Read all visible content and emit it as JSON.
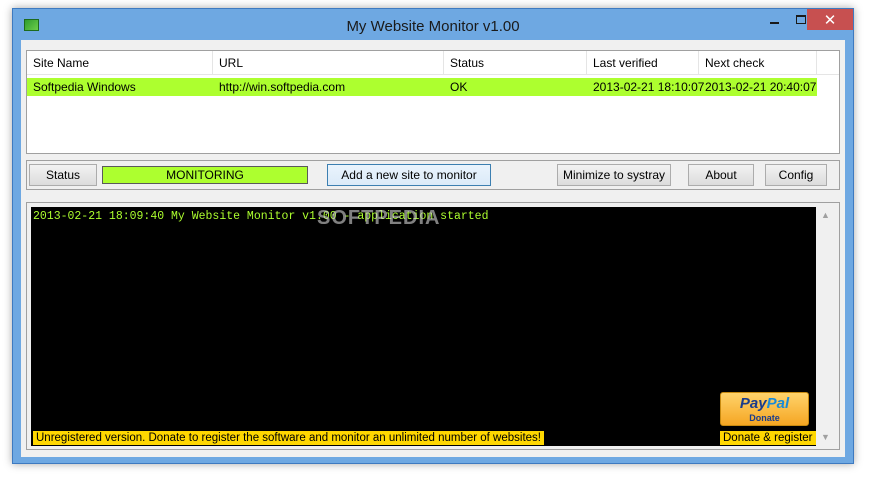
{
  "window": {
    "title": "My Website Monitor v1.00",
    "close_glyph": "✕"
  },
  "list": {
    "columns": [
      "Site Name",
      "URL",
      "Status",
      "Last verified",
      "Next check"
    ],
    "rows": [
      {
        "site_name": "Softpedia Windows",
        "url": "http://win.softpedia.com",
        "status": "OK",
        "last_verified": "2013-02-21 18:10:07",
        "next_check": "2013-02-21 20:40:07"
      }
    ]
  },
  "toolbar": {
    "status_label": "Status",
    "monitoring_state": "MONITORING",
    "add_site_label": "Add a new site to monitor",
    "minimize_label": "Minimize to systray",
    "about_label": "About",
    "config_label": "Config"
  },
  "log": {
    "lines": [
      "2013-02-21 18:09:40 My Website Monitor v1.00 - application started"
    ],
    "unregistered_notice": "Unregistered version. Donate to register the software and monitor an unlimited number of websites!",
    "paypal_brand_pay": "Pay",
    "paypal_brand_pal": "Pal",
    "paypal_donate": "Donate",
    "donate_register_label": "Donate & register"
  },
  "watermark": "SOFTPEDIA",
  "colors": {
    "accent_green": "#adff2f",
    "notice_yellow": "#ffd700",
    "titlebar_blue": "#6ea8e2",
    "close_red": "#c75050"
  }
}
